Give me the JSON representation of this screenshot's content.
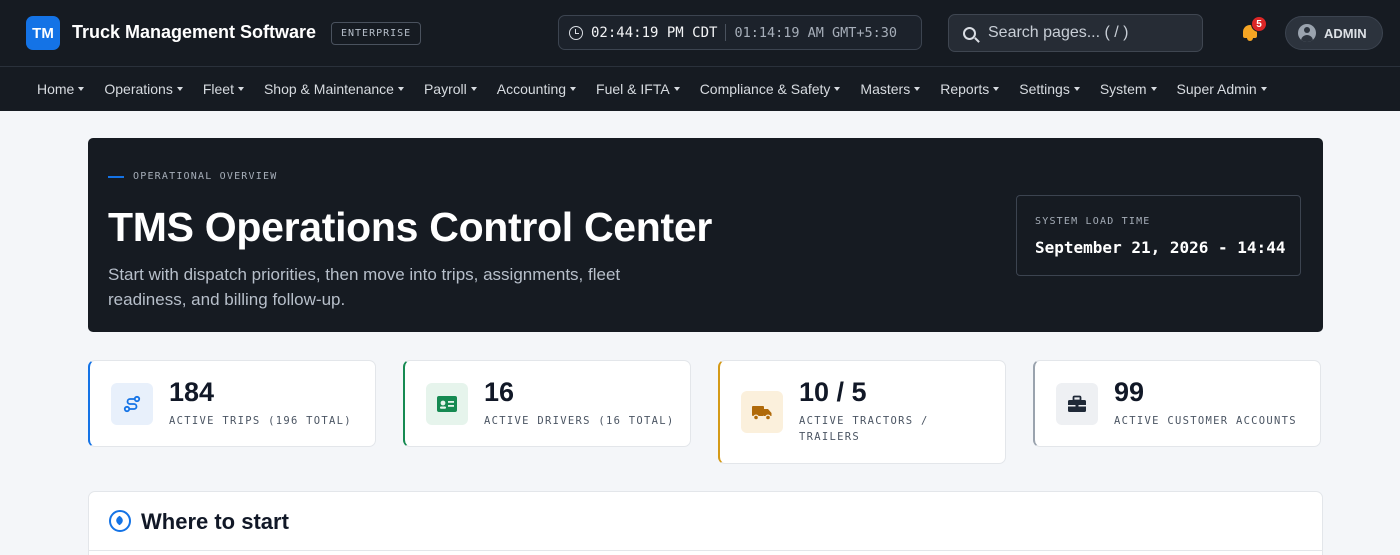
{
  "header": {
    "logo_text": "TM",
    "app_title": "Truck Management Software",
    "edition_badge": "ENTERPRISE",
    "clock_primary": "02:44:19 PM CDT",
    "clock_secondary": "01:14:19 AM GMT+5:30",
    "search_placeholder": "Search pages... ( / )",
    "notification_count": "5",
    "user_label": "ADMIN"
  },
  "nav": {
    "items": [
      {
        "label": "Home"
      },
      {
        "label": "Operations"
      },
      {
        "label": "Fleet"
      },
      {
        "label": "Shop & Maintenance"
      },
      {
        "label": "Payroll"
      },
      {
        "label": "Accounting"
      },
      {
        "label": "Fuel & IFTA"
      },
      {
        "label": "Compliance & Safety"
      },
      {
        "label": "Masters"
      },
      {
        "label": "Reports"
      },
      {
        "label": "Settings"
      },
      {
        "label": "System"
      },
      {
        "label": "Super Admin"
      }
    ]
  },
  "hero": {
    "eyebrow": "OPERATIONAL OVERVIEW",
    "title": "TMS Operations Control Center",
    "subtitle": "Start with dispatch priorities, then move into trips, assignments, fleet readiness, and billing follow-up.",
    "load_time_label": "SYSTEM LOAD TIME",
    "load_time_value": "September 21, 2026 - 14:44"
  },
  "stats": [
    {
      "value": "184",
      "label": "ACTIVE TRIPS (196 TOTAL)",
      "icon": "route-icon",
      "accent": "#1473e6",
      "icon_bg": "#e8f0fb"
    },
    {
      "value": "16",
      "label": "ACTIVE DRIVERS (16 TOTAL)",
      "icon": "id-card-icon",
      "accent": "#168a52",
      "icon_bg": "#e6f4ec"
    },
    {
      "value": "10 / 5",
      "label": "ACTIVE TRACTORS / TRAILERS",
      "icon": "truck-icon",
      "accent": "#d49a18",
      "icon_bg": "#fbf0dc"
    },
    {
      "value": "99",
      "label": "ACTIVE CUSTOMER ACCOUNTS",
      "icon": "briefcase-icon",
      "accent": "#9aa3ae",
      "icon_bg": "#eef0f3"
    }
  ],
  "where_to_start": {
    "title": "Where to start"
  }
}
